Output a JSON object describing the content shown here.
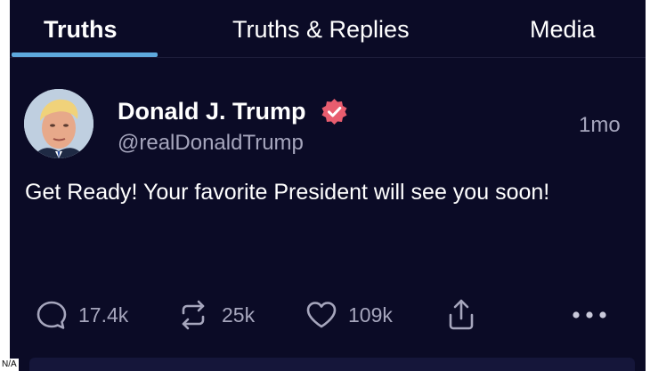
{
  "tabs": {
    "truths": "Truths",
    "replies": "Truths & Replies",
    "media": "Media"
  },
  "post": {
    "author_name": "Donald J. Trump",
    "handle": "@realDonaldTrump",
    "time": "1mo",
    "text": "Get Ready! Your favorite President will see you soon!",
    "verified": true
  },
  "actions": {
    "replies": "17.4k",
    "retruths": "25k",
    "likes": "109k"
  },
  "overlay": {
    "label": "N/A"
  },
  "colors": {
    "background": "#0b0b26",
    "tab_indicator": "#5ea9dd",
    "verified_badge": "#e85d6f",
    "secondary_text": "#a6a6bd"
  },
  "icons": [
    "reply-icon",
    "retruth-icon",
    "heart-icon",
    "share-icon",
    "more-icon",
    "verified-icon"
  ]
}
